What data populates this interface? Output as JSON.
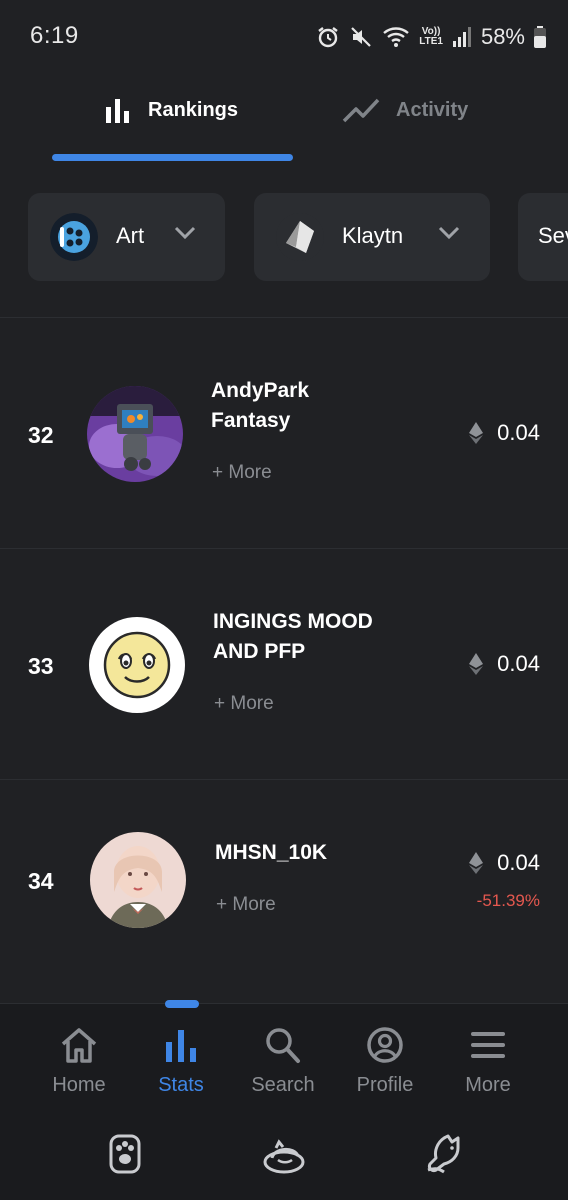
{
  "status_bar": {
    "time": "6:19",
    "volte_top": "Vo))",
    "volte_bottom": "LTE1",
    "battery": "58%"
  },
  "tabs": [
    {
      "label": "Rankings",
      "icon": "bar-chart-icon",
      "active": true
    },
    {
      "label": "Activity",
      "icon": "trend-line-icon",
      "active": false
    }
  ],
  "filters": [
    {
      "label": "Art",
      "icon": "art-category-icon"
    },
    {
      "label": "Klaytn",
      "icon": "klaytn-logo-icon"
    },
    {
      "label": "Sev"
    }
  ],
  "collections": [
    {
      "rank": "32",
      "name_line1": "AndyPark",
      "name_line2": "Fantasy",
      "more": "+ More",
      "price": "0.04",
      "change": ""
    },
    {
      "rank": "33",
      "name_line1": "INGINGS MOOD",
      "name_line2": "AND PFP",
      "more": "+ More",
      "price": "0.04",
      "change": ""
    },
    {
      "rank": "34",
      "name_line1": "MHSN_10K",
      "name_line2": "",
      "more": "+ More",
      "price": "0.04",
      "change": "-51.39%"
    }
  ],
  "bottom_nav": [
    {
      "label": "Home",
      "icon": "home-icon",
      "active": false
    },
    {
      "label": "Stats",
      "icon": "stats-icon",
      "active": true
    },
    {
      "label": "Search",
      "icon": "search-icon",
      "active": false
    },
    {
      "label": "Profile",
      "icon": "profile-icon",
      "active": false
    },
    {
      "label": "More",
      "icon": "menu-icon",
      "active": false
    }
  ],
  "colors": {
    "background": "#202124",
    "accent": "#3f86e6",
    "negative": "#e4584f",
    "muted_text": "#8a8d92"
  }
}
